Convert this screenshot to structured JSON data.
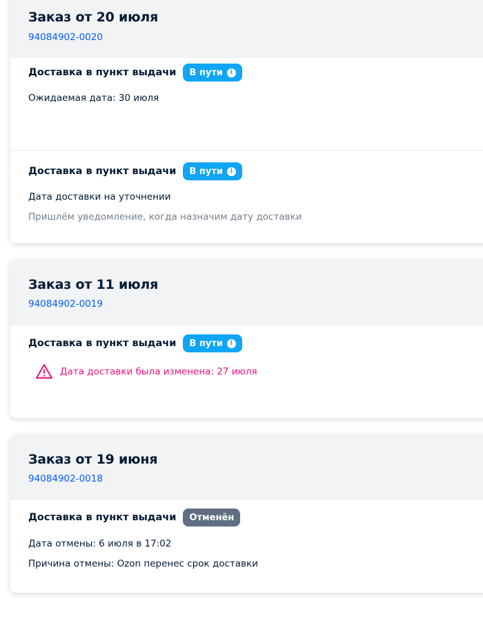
{
  "orders": [
    {
      "title": "Заказ от 20 июля",
      "number": "94084902-0020",
      "shipments": [
        {
          "delivery_type": "Доставка в пункт выдачи",
          "status": "В пути",
          "lines": [
            "Ожидаемая дата: 30 июля"
          ]
        },
        {
          "delivery_type": "Доставка в пункт выдачи",
          "status": "В пути",
          "lines": [
            "Дата доставки на уточнении",
            "Пришлём уведомление, когда назначим дату доставки"
          ]
        }
      ]
    },
    {
      "title": "Заказ от 11 июля",
      "number": "94084902-0019",
      "shipments": [
        {
          "delivery_type": "Доставка в пункт выдачи",
          "status": "В пути",
          "warning": "Дата доставки была изменена: 27 июля"
        }
      ]
    },
    {
      "title": "Заказ от 19 июня",
      "number": "94084902-0018",
      "shipments": [
        {
          "delivery_type": "Доставка в пункт выдачи",
          "status": "Отменён",
          "lines": [
            "Дата отмены: 6 июля в 17:02",
            "Причина отмены: Ozon перенес срок доставки"
          ]
        }
      ]
    }
  ],
  "colors": {
    "link": "#005bff",
    "status_transit": "#10a5f5",
    "status_cancelled": "#5f6e82",
    "warning": "#f1117e",
    "header_bg": "#f2f3f5"
  },
  "icons": {
    "status_info": "info-icon",
    "warning": "warning-triangle-icon"
  }
}
